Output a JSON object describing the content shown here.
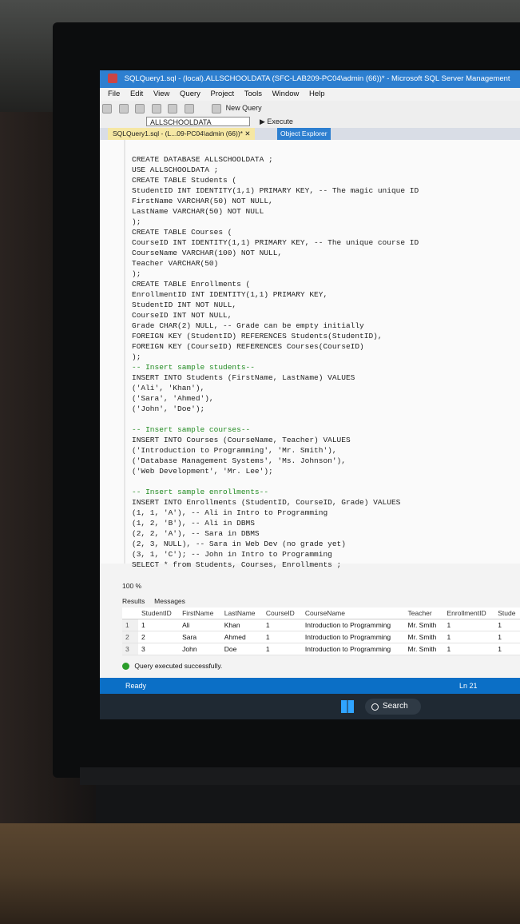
{
  "window": {
    "title": "SQLQuery1.sql - (local).ALLSCHOOLDATA (SFC-LAB209-PC04\\admin (66))* - Microsoft SQL Server Management",
    "menu": [
      "File",
      "Edit",
      "View",
      "Query",
      "Project",
      "Tools",
      "Window",
      "Help"
    ],
    "new_query_label": "New Query",
    "database_selected": "ALLSCHOOLDATA",
    "execute_label": "Execute",
    "tab_label": "SQLQuery1.sql - (L...09-PC04\\admin (66))*",
    "object_explorer_label": "Object Explorer"
  },
  "editor": {
    "lines": [
      "CREATE DATABASE ALLSCHOOLDATA ;",
      "USE ALLSCHOOLDATA ;",
      "CREATE TABLE Students (",
      "StudentID INT IDENTITY(1,1) PRIMARY KEY, -- The magic unique ID",
      "FirstName VARCHAR(50) NOT NULL,",
      "LastName VARCHAR(50) NOT NULL",
      ");",
      "CREATE TABLE Courses (",
      "CourseID INT IDENTITY(1,1) PRIMARY KEY, -- The unique course ID",
      "CourseName VARCHAR(100) NOT NULL,",
      "Teacher VARCHAR(50)",
      ");",
      "CREATE TABLE Enrollments (",
      "EnrollmentID INT IDENTITY(1,1) PRIMARY KEY,",
      "StudentID INT NOT NULL,",
      "CourseID INT NOT NULL,",
      "Grade CHAR(2) NULL, -- Grade can be empty initially",
      "FOREIGN KEY (StudentID) REFERENCES Students(StudentID),",
      "FOREIGN KEY (CourseID) REFERENCES Courses(CourseID)",
      ");",
      "-- Insert sample students--",
      "INSERT INTO Students (FirstName, LastName) VALUES",
      "('Ali', 'Khan'),",
      "('Sara', 'Ahmed'),",
      "('John', 'Doe');",
      "",
      "-- Insert sample courses--",
      "INSERT INTO Courses (CourseName, Teacher) VALUES",
      "('Introduction to Programming', 'Mr. Smith'),",
      "('Database Management Systems', 'Ms. Johnson'),",
      "('Web Development', 'Mr. Lee');",
      "",
      "-- Insert sample enrollments--",
      "INSERT INTO Enrollments (StudentID, CourseID, Grade) VALUES",
      "(1, 1, 'A'), -- Ali in Intro to Programming",
      "(1, 2, 'B'), -- Ali in DBMS",
      "(2, 2, 'A'), -- Sara in DBMS",
      "(2, 3, NULL), -- Sara in Web Dev (no grade yet)",
      "(3, 1, 'C'); -- John in Intro to Programming",
      "SELECT * from Students, Courses, Enrollments ;"
    ]
  },
  "results": {
    "zoom": "100 %",
    "tab_results": "Results",
    "tab_messages": "Messages",
    "columns": [
      "StudentID",
      "FirstName",
      "LastName",
      "CourseID",
      "CourseName",
      "Teacher",
      "EnrollmentID",
      "Stude"
    ],
    "rows": [
      [
        "1",
        "1",
        "Ali",
        "Khan",
        "1",
        "Introduction to Programming",
        "Mr. Smith",
        "1",
        "1"
      ],
      [
        "2",
        "2",
        "Sara",
        "Ahmed",
        "1",
        "Introduction to Programming",
        "Mr. Smith",
        "1",
        "1"
      ],
      [
        "3",
        "3",
        "John",
        "Doe",
        "1",
        "Introduction to Programming",
        "Mr. Smith",
        "1",
        "1"
      ]
    ],
    "status_message": "Query executed successfully."
  },
  "statusbar": {
    "ready": "Ready",
    "line": "Ln 21"
  },
  "taskbar": {
    "search_label": "Search"
  }
}
